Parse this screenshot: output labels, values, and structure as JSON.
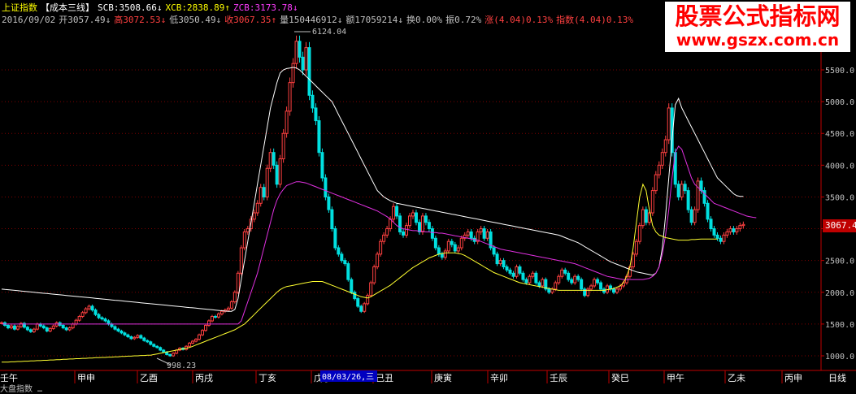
{
  "header": {
    "index_name": "上证指数",
    "indicator_name": "【成本三线】",
    "scb": "SCB:3508.66↓",
    "xcb": "XCB:2838.89↑",
    "zcb": "ZCB:3173.78↓",
    "date": "2016/09/02",
    "open": "开3057.49↓",
    "high": "高3072.53↓",
    "low": "低3050.49↓",
    "close": "收3067.35↑",
    "volume": "量150446912↓",
    "amount": "额17059214↓",
    "turnover": "换0.00%",
    "amplitude": "振0.72%",
    "change": "涨(4.04)0.13%",
    "index_change": "指数(4.04)0.13%"
  },
  "watermark": {
    "title": "股票公式指标网",
    "url": "www.gszx.com.cn"
  },
  "price_tag": "3067.4",
  "annotations": {
    "peak1": "6124.04",
    "low1": "998.23"
  },
  "cursor_date": "08/03/26,三",
  "footer_text": "大盘指数 …",
  "colors": {
    "background": "#000000",
    "up": "#ff4040",
    "down": "#00e0e0",
    "scb": "#ffffff",
    "zcb": "#e030e0",
    "xcb": "#ffff30",
    "axis": "#c00000"
  },
  "chart_data": {
    "type": "line",
    "title": "",
    "ylim": [
      800,
      6300
    ],
    "y_ticks": [
      1000,
      1500,
      2000,
      2500,
      3000,
      3500,
      4000,
      4500,
      5000,
      5500
    ],
    "y_tick_labels": [
      "1000.0",
      "1500.0",
      "2000.0",
      "2500.0",
      "3000.0",
      "3500.0",
      "4000.0",
      "4500.0",
      "5000.0",
      "5500.0"
    ],
    "x_labels": [
      "壬午",
      "甲申",
      "乙酉",
      "丙戌",
      "丁亥",
      "戊子",
      "己丑",
      "庚寅",
      "辛卯",
      "壬辰",
      "癸巳",
      "甲午",
      "乙未",
      "丙申",
      "日线"
    ],
    "x": [
      0,
      4,
      8,
      12,
      16,
      20,
      24,
      28,
      32,
      36,
      40,
      44,
      48,
      52,
      56,
      60,
      64,
      68,
      72,
      76,
      80,
      84,
      88,
      92,
      96,
      100,
      104,
      108,
      112,
      116,
      120,
      124,
      128,
      132,
      136,
      140,
      144,
      148,
      152,
      156,
      160,
      164,
      168,
      172,
      176,
      180,
      184,
      188,
      192,
      196,
      200,
      204,
      208,
      212,
      216,
      220,
      224,
      228,
      232,
      236,
      240,
      244,
      248,
      252,
      256,
      260,
      264,
      268,
      272,
      276,
      280,
      284,
      288,
      292,
      296,
      300,
      304,
      308,
      312,
      316,
      320,
      324,
      328,
      332,
      336,
      340,
      344,
      348,
      352,
      356,
      360,
      364,
      368,
      372,
      376,
      380,
      384,
      388,
      392,
      396,
      400,
      404,
      408,
      412,
      416,
      420,
      424,
      428,
      432,
      436,
      440,
      444,
      448,
      452,
      456,
      460,
      464,
      468,
      472,
      476,
      480,
      484,
      488,
      492,
      496,
      500,
      504,
      508,
      512,
      516,
      520,
      524,
      528,
      532,
      536,
      540,
      544,
      548,
      552,
      556,
      560,
      564,
      568,
      572,
      576,
      580,
      584,
      588,
      592,
      596,
      600,
      604,
      608,
      612,
      616,
      620,
      624,
      628,
      632,
      636,
      640,
      644,
      648,
      652,
      656,
      660,
      664,
      668,
      672,
      676,
      680,
      684,
      688,
      692,
      696,
      700,
      704,
      708,
      712,
      716,
      720,
      724,
      728,
      732,
      736,
      740,
      744,
      748,
      752,
      756,
      760,
      764,
      768,
      772,
      776,
      780,
      784,
      788,
      792,
      796,
      800,
      804,
      808,
      812,
      816,
      820,
      824,
      828,
      832,
      836,
      840,
      844,
      848,
      852,
      856,
      860,
      864,
      868,
      872,
      876,
      880,
      884,
      888,
      892,
      896,
      900,
      904,
      908,
      912,
      916,
      920,
      924,
      928,
      932,
      936,
      940,
      944,
      948,
      952,
      956,
      960,
      964,
      968,
      972,
      976,
      980,
      984,
      988,
      992,
      996,
      1000,
      1004,
      1008
    ],
    "series": [
      {
        "name": "收盘",
        "values": [
          1520,
          1480,
          1440,
          1470,
          1420,
          1460,
          1510,
          1450,
          1410,
          1380,
          1420,
          1500,
          1470,
          1440,
          1390,
          1430,
          1470,
          1520,
          1480,
          1440,
          1410,
          1440,
          1500,
          1560,
          1620,
          1680,
          1740,
          1780,
          1720,
          1650,
          1600,
          1580,
          1550,
          1500,
          1460,
          1420,
          1390,
          1360,
          1330,
          1300,
          1270,
          1290,
          1320,
          1280,
          1240,
          1220,
          1180,
          1150,
          1130,
          1090,
          1060,
          1020,
          1000,
          1040,
          1090,
          1120,
          1100,
          1150,
          1200,
          1230,
          1260,
          1330,
          1400,
          1480,
          1550,
          1620,
          1610,
          1660,
          1700,
          1720,
          1750,
          1850,
          2000,
          2300,
          2700,
          2950,
          3000,
          3150,
          3250,
          3400,
          3650,
          3500,
          3950,
          4200,
          4000,
          3700,
          4100,
          4500,
          4850,
          5300,
          5600,
          5950,
          5700,
          5500,
          5850,
          5100,
          4900,
          4700,
          4200,
          3800,
          3500,
          3300,
          3000,
          2700,
          2600,
          2500,
          2450,
          2200,
          2000,
          1900,
          1780,
          1700,
          1820,
          1950,
          2150,
          2400,
          2600,
          2800,
          2900,
          3000,
          3150,
          3350,
          3200,
          2950,
          2900,
          3050,
          3200,
          3250,
          3100,
          2950,
          3200,
          3100,
          3000,
          2850,
          2700,
          2600,
          2550,
          2650,
          2800,
          2750,
          2650,
          2700,
          2850,
          2900,
          2950,
          2850,
          2800,
          2950,
          3000,
          2850,
          2950,
          2700,
          2600,
          2450,
          2500,
          2400,
          2350,
          2300,
          2250,
          2400,
          2300,
          2200,
          2150,
          2250,
          2300,
          2150,
          2100,
          2200,
          2050,
          2000,
          2050,
          2150,
          2250,
          2350,
          2300,
          2200,
          2150,
          2250,
          2200,
          2050,
          1950,
          2050,
          2100,
          2200,
          2150,
          2050,
          2000,
          2100,
          2050,
          2000,
          2050,
          2100,
          2150,
          2250,
          2400,
          2600,
          2800,
          3050,
          3300,
          3100,
          3250,
          3600,
          3850,
          4000,
          4200,
          4400,
          4900,
          4200,
          3700,
          3500,
          3700,
          3600,
          3300,
          3100,
          3300,
          3750,
          3600,
          3400,
          3150,
          3000,
          2900,
          2850,
          2800,
          2900,
          2950,
          3000,
          2950,
          3000,
          3050,
          3067
        ]
      },
      {
        "name": "SCB",
        "values": [
          2050,
          2045,
          2040,
          2035,
          2030,
          2025,
          2020,
          2015,
          2010,
          2005,
          2000,
          1995,
          1990,
          1985,
          1980,
          1975,
          1970,
          1965,
          1960,
          1955,
          1950,
          1945,
          1940,
          1935,
          1930,
          1925,
          1920,
          1915,
          1910,
          1905,
          1900,
          1895,
          1890,
          1885,
          1880,
          1875,
          1870,
          1865,
          1860,
          1855,
          1850,
          1845,
          1840,
          1835,
          1830,
          1825,
          1820,
          1815,
          1810,
          1805,
          1800,
          1795,
          1790,
          1785,
          1780,
          1775,
          1770,
          1765,
          1760,
          1755,
          1750,
          1745,
          1740,
          1735,
          1730,
          1725,
          1720,
          1715,
          1710,
          1705,
          1700,
          1700,
          1730,
          1900,
          2200,
          2500,
          2800,
          3100,
          3400,
          3700,
          4000,
          4300,
          4600,
          4900,
          5100,
          5300,
          5450,
          5500,
          5520,
          5530,
          5540,
          5530,
          5500,
          5450,
          5400,
          5350,
          5300,
          5250,
          5200,
          5150,
          5100,
          5050,
          5000,
          4900,
          4800,
          4700,
          4600,
          4500,
          4400,
          4300,
          4200,
          4100,
          4000,
          3900,
          3800,
          3700,
          3600,
          3550,
          3500,
          3470,
          3440,
          3420,
          3400,
          3390,
          3380,
          3370,
          3360,
          3350,
          3340,
          3330,
          3320,
          3310,
          3300,
          3290,
          3280,
          3270,
          3260,
          3250,
          3240,
          3230,
          3220,
          3210,
          3200,
          3190,
          3180,
          3170,
          3160,
          3150,
          3140,
          3130,
          3120,
          3110,
          3100,
          3090,
          3080,
          3070,
          3060,
          3050,
          3040,
          3030,
          3020,
          3010,
          3000,
          2990,
          2980,
          2970,
          2960,
          2950,
          2940,
          2930,
          2920,
          2910,
          2900,
          2880,
          2860,
          2840,
          2820,
          2800,
          2780,
          2750,
          2720,
          2690,
          2660,
          2630,
          2600,
          2570,
          2540,
          2510,
          2480,
          2460,
          2440,
          2420,
          2400,
          2380,
          2360,
          2340,
          2320,
          2310,
          2300,
          2290,
          2280,
          2270,
          2300,
          2400,
          2700,
          3200,
          3800,
          4400,
          4950,
          5050,
          4900,
          4800,
          4700,
          4600,
          4500,
          4400,
          4300,
          4200,
          4100,
          4000,
          3900,
          3800,
          3750,
          3700,
          3650,
          3600,
          3550,
          3520,
          3510,
          3508
        ]
      },
      {
        "name": "ZCB",
        "values": [
          1500,
          1500,
          1500,
          1500,
          1500,
          1500,
          1500,
          1500,
          1500,
          1500,
          1500,
          1500,
          1500,
          1500,
          1500,
          1500,
          1500,
          1500,
          1500,
          1500,
          1500,
          1500,
          1500,
          1500,
          1500,
          1500,
          1500,
          1500,
          1500,
          1500,
          1500,
          1500,
          1500,
          1500,
          1500,
          1500,
          1500,
          1500,
          1500,
          1500,
          1500,
          1500,
          1500,
          1500,
          1500,
          1500,
          1500,
          1500,
          1500,
          1500,
          1500,
          1500,
          1500,
          1500,
          1500,
          1500,
          1500,
          1500,
          1500,
          1500,
          1500,
          1500,
          1500,
          1500,
          1500,
          1500,
          1500,
          1500,
          1500,
          1500,
          1500,
          1500,
          1500,
          1500,
          1550,
          1700,
          1850,
          2000,
          2150,
          2300,
          2500,
          2700,
          2900,
          3100,
          3300,
          3450,
          3550,
          3620,
          3680,
          3700,
          3720,
          3740,
          3740,
          3730,
          3720,
          3700,
          3680,
          3660,
          3640,
          3620,
          3600,
          3580,
          3560,
          3540,
          3520,
          3500,
          3480,
          3460,
          3440,
          3420,
          3400,
          3380,
          3360,
          3340,
          3320,
          3300,
          3280,
          3250,
          3220,
          3190,
          3150,
          3100,
          3050,
          3020,
          3000,
          2990,
          2980,
          2970,
          2970,
          2960,
          2960,
          2950,
          2950,
          2940,
          2940,
          2930,
          2930,
          2920,
          2910,
          2900,
          2890,
          2880,
          2870,
          2860,
          2850,
          2840,
          2830,
          2820,
          2800,
          2780,
          2760,
          2740,
          2720,
          2700,
          2680,
          2670,
          2660,
          2650,
          2640,
          2630,
          2620,
          2610,
          2600,
          2590,
          2580,
          2570,
          2560,
          2550,
          2540,
          2530,
          2520,
          2510,
          2500,
          2490,
          2480,
          2470,
          2460,
          2450,
          2430,
          2410,
          2390,
          2370,
          2350,
          2330,
          2310,
          2290,
          2270,
          2250,
          2240,
          2230,
          2220,
          2210,
          2200,
          2200,
          2200,
          2200,
          2200,
          2200,
          2200,
          2210,
          2220,
          2250,
          2300,
          2400,
          2600,
          2900,
          3300,
          3800,
          4200,
          4300,
          4250,
          4100,
          3950,
          3800,
          3700,
          3650,
          3600,
          3550,
          3500,
          3450,
          3400,
          3380,
          3360,
          3340,
          3320,
          3300,
          3280,
          3260,
          3240,
          3220,
          3200,
          3190,
          3180,
          3173
        ]
      },
      {
        "name": "XCB",
        "values": [
          900,
          900,
          900,
          905,
          905,
          910,
          910,
          915,
          915,
          920,
          920,
          925,
          925,
          930,
          930,
          935,
          935,
          940,
          940,
          945,
          945,
          950,
          950,
          955,
          955,
          960,
          960,
          965,
          965,
          970,
          970,
          975,
          975,
          980,
          980,
          985,
          985,
          990,
          990,
          995,
          995,
          1000,
          1000,
          1005,
          1005,
          1010,
          1010,
          1020,
          1030,
          1040,
          1050,
          1060,
          1070,
          1080,
          1090,
          1100,
          1110,
          1120,
          1130,
          1150,
          1170,
          1190,
          1210,
          1230,
          1250,
          1270,
          1290,
          1310,
          1330,
          1350,
          1370,
          1390,
          1410,
          1440,
          1470,
          1500,
          1550,
          1600,
          1650,
          1700,
          1750,
          1800,
          1850,
          1900,
          1950,
          2000,
          2040,
          2070,
          2090,
          2100,
          2110,
          2120,
          2130,
          2140,
          2150,
          2160,
          2170,
          2170,
          2170,
          2170,
          2150,
          2130,
          2110,
          2090,
          2070,
          2050,
          2030,
          2010,
          1990,
          1970,
          1950,
          1930,
          1920,
          1910,
          1930,
          1960,
          1990,
          2020,
          2050,
          2080,
          2110,
          2150,
          2190,
          2230,
          2270,
          2310,
          2350,
          2390,
          2420,
          2450,
          2480,
          2510,
          2540,
          2560,
          2580,
          2600,
          2610,
          2620,
          2620,
          2620,
          2620,
          2610,
          2600,
          2580,
          2550,
          2520,
          2490,
          2460,
          2430,
          2400,
          2370,
          2340,
          2310,
          2290,
          2270,
          2250,
          2230,
          2210,
          2190,
          2170,
          2150,
          2140,
          2130,
          2120,
          2110,
          2100,
          2090,
          2080,
          2070,
          2060,
          2050,
          2040,
          2030,
          2030,
          2030,
          2030,
          2030,
          2030,
          2030,
          2030,
          2030,
          2030,
          2030,
          2030,
          2030,
          2030,
          2030,
          2040,
          2050,
          2060,
          2080,
          2100,
          2150,
          2250,
          2400,
          2700,
          3100,
          3500,
          3700,
          3600,
          3300,
          3050,
          2950,
          2900,
          2880,
          2860,
          2850,
          2840,
          2830,
          2820,
          2820,
          2820,
          2820,
          2830,
          2830,
          2835,
          2838,
          2838,
          2838,
          2838,
          2838,
          2838
        ]
      }
    ]
  }
}
